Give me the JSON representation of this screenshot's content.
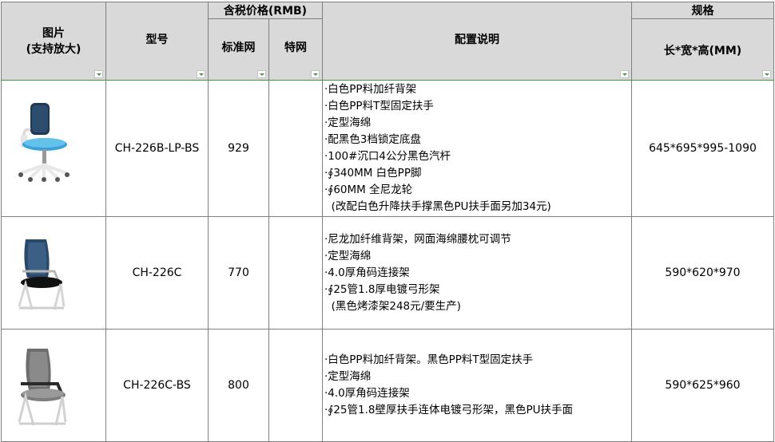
{
  "header": {
    "image_col": [
      "图片",
      "(支持放大)"
    ],
    "model_col": "型号",
    "price_group": "含税价格(RMB)",
    "price_standard": "标准网",
    "price_special": "特网",
    "config_col": "配置说明",
    "spec_group": "规格",
    "spec_sub": "长*宽*高(MM)"
  },
  "rows": [
    {
      "model": "CH-226B-LP-BS",
      "price": "929",
      "special": "",
      "config": [
        "·白色PP料加纤背架",
        "·白色PP料T型固定扶手",
        "·定型海绵",
        "·配黑色3档锁定底盘",
        "·100#沉口4公分黑色汽杆",
        "·∮340MM 白色PP脚",
        "·∮60MM 全尼龙轮",
        "  (改配白色升降扶手撑黑色PU扶手面另加34元)"
      ],
      "dims": "645*695*995-1090",
      "image_icon": "office-chair-blue-mesh-icon"
    },
    {
      "model": "CH-226C",
      "price": "770",
      "special": "",
      "config": [
        "·尼龙加纤维背架，网面海绵腰枕可调节",
        "·定型海绵",
        "·4.0厚角码连接架",
        "·∮25管1.8厚电镀弓形架",
        "  (黑色烤漆架248元/要生产)"
      ],
      "dims": "590*620*970",
      "image_icon": "visitor-chair-blue-mesh-icon"
    },
    {
      "model": "CH-226C-BS",
      "price": "800",
      "special": "",
      "config": [
        "·白色PP料加纤背架。黑色PP料T型固定扶手",
        "·定型海绵",
        "·4.0厚角码连接架",
        "·∮25管1.8壁厚扶手连体电镀弓形架，黑色PU扶手面"
      ],
      "dims": "590*625*960",
      "image_icon": "visitor-chair-grey-mesh-icon"
    }
  ]
}
